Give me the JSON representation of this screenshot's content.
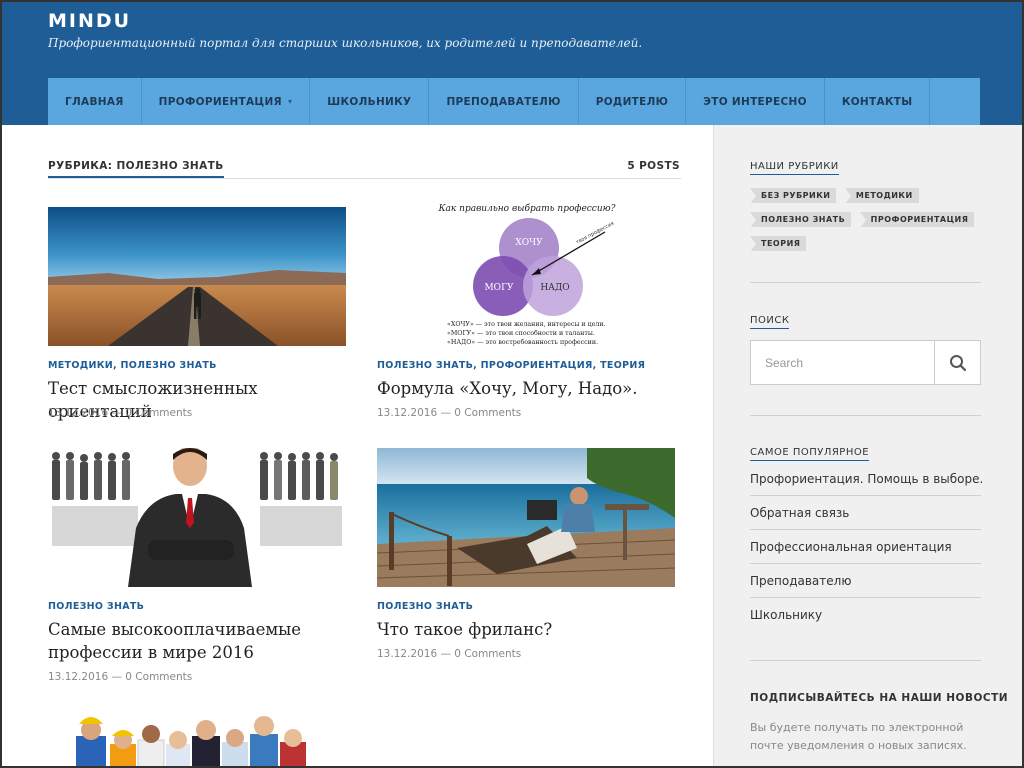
{
  "site": {
    "title": "MINDU",
    "description": "Профориентационный портал для старших школьников, их родителей и преподавателей."
  },
  "nav": {
    "items": [
      {
        "label": "ГЛАВНАЯ"
      },
      {
        "label": "ПРОФОРИЕНТАЦИЯ",
        "has_dropdown": true
      },
      {
        "label": "ШКОЛЬНИКУ"
      },
      {
        "label": "ПРЕПОДАВАТЕЛЮ"
      },
      {
        "label": "РОДИТЕЛЮ"
      },
      {
        "label": "ЭТО ИНТЕРЕСНО"
      },
      {
        "label": "КОНТАКТЫ"
      }
    ]
  },
  "archive": {
    "title": "РУБРИКА: ПОЛЕЗНО ЗНАТЬ",
    "count": "5 POSTS"
  },
  "posts": [
    {
      "categories": "МЕТОДИКИ, ПОЛЕЗНО ЗНАТЬ",
      "title": "Тест смысложизненных ориентаций",
      "meta": "13.12.2016 — 0 Comments"
    },
    {
      "categories": "ПОЛЕЗНО ЗНАТЬ, ПРОФОРИЕНТАЦИЯ, ТЕОРИЯ",
      "title": "Формула «Хочу, Могу, Надо».",
      "meta": "13.12.2016 — 0 Comments"
    },
    {
      "categories": "ПОЛЕЗНО ЗНАТЬ",
      "title": "Самые высокооплачиваемые профессии в мире 2016",
      "meta": "13.12.2016 — 0 Comments"
    },
    {
      "categories": "ПОЛЕЗНО ЗНАТЬ",
      "title": "Что такое фриланс?",
      "meta": "13.12.2016 — 0 Comments"
    }
  ],
  "venn": {
    "heading": "Как правильно выбрать профессию?",
    "circles": [
      "ХОЧУ",
      "МОГУ",
      "НАДО"
    ],
    "arrow_label": "твоя профессия",
    "lines": [
      "«ХОЧУ» — это твои желания, интересы и цели.",
      "«МОГУ» — это твои способности и таланты.",
      "«НАДО» — это востребованность профессии."
    ]
  },
  "sidebar": {
    "categories": {
      "title": "НАШИ РУБРИКИ",
      "tags": [
        "БЕЗ РУБРИКИ",
        "МЕТОДИКИ",
        "ПОЛЕЗНО ЗНАТЬ",
        "ПРОФОРИЕНТАЦИЯ",
        "ТЕОРИЯ"
      ]
    },
    "search": {
      "title": "ПОИСК",
      "placeholder": "Search"
    },
    "popular": {
      "title": "САМОЕ ПОПУЛЯРНОЕ",
      "items": [
        "Профориентация. Помощь в выборе.",
        "Обратная связь",
        "Профессиональная ориентация",
        "Преподавателю",
        "Школьнику"
      ]
    },
    "subscribe": {
      "title": "ПОДПИСЫВАЙТЕСЬ НА НАШИ НОВОСТИ",
      "text": "Вы будете получать по электронной почте уведомления о новых записях."
    }
  },
  "colors": {
    "header_bg": "#1f5d96",
    "nav_bg": "#5aa7df",
    "accent": "#1f5d96",
    "sidebar_bg": "#f0f0f0"
  }
}
